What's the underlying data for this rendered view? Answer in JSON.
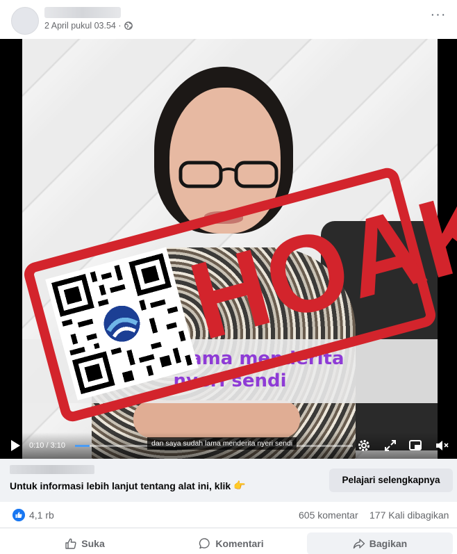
{
  "post": {
    "timestamp": "2 April pukul 03.54 ·",
    "more_label": "···"
  },
  "video": {
    "caption_lines": [
      "sudah lama menderita",
      "nyeri sendi"
    ],
    "stamp_text": "HOAKS",
    "time": "0:10 / 3:10",
    "progress_fraction": 0.0526,
    "subtitle": "dan saya sudah lama menderita nyeri sendi",
    "icons": [
      "play-icon",
      "settings-icon",
      "fullscreen-icon",
      "pip-icon",
      "volume-muted-icon"
    ]
  },
  "ad": {
    "text": "Untuk informasi lebih lanjut tentang alat ini, klik",
    "emoji": "👉",
    "button_label": "Pelajari selengkapnya"
  },
  "reactions": {
    "like_count": "4,1 rb",
    "comments": "605 komentar",
    "shares": "177 Kali dibagikan"
  },
  "actions": {
    "like_label": "Suka",
    "comment_label": "Komentari",
    "share_label": "Bagikan"
  },
  "colors": {
    "brand_blue": "#1877f2",
    "stamp_red": "#d3242c",
    "caption_purple": "#8e3bd6"
  }
}
